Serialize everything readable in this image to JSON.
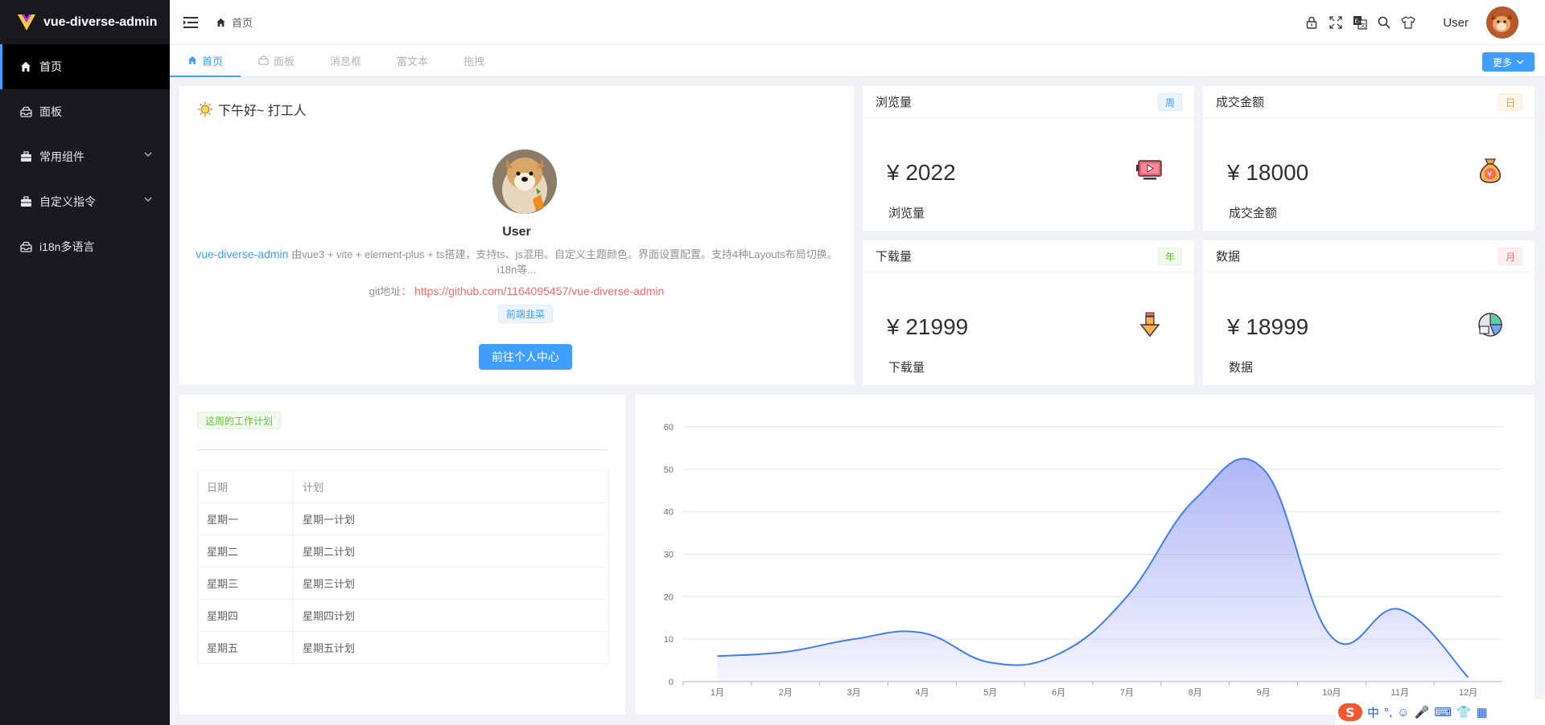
{
  "app": {
    "title": "vue-diverse-admin"
  },
  "sidebar": {
    "items": [
      {
        "label": "首页",
        "icon": "home-icon",
        "active": true
      },
      {
        "label": "面板",
        "icon": "dashboard-icon"
      },
      {
        "label": "常用组件",
        "icon": "briefcase-icon",
        "has_children": true
      },
      {
        "label": "自定义指令",
        "icon": "briefcase-icon",
        "has_children": true
      },
      {
        "label": "i18n多语言",
        "icon": "dashboard-icon"
      }
    ]
  },
  "header": {
    "breadcrumb": "首页",
    "user_name": "User",
    "icons": [
      "lock-icon",
      "fullscreen-icon",
      "translate-icon",
      "search-icon",
      "tshirt-icon"
    ]
  },
  "tabs": {
    "items": [
      "首页",
      "面板",
      "消息框",
      "富文本",
      "拖拽"
    ],
    "more_label": "更多"
  },
  "welcome": {
    "greeting": "下午好~ 打工人",
    "user_name": "User",
    "project_link": "vue-diverse-admin",
    "description": "由vue3 + vite + element-plus + ts搭建，支持ts、js混用。自定义主题颜色。界面设置配置。支持4种Layouts布局切换。i18n等...",
    "git_label": "git地址：",
    "git_url": "https://github.com/1164095457/vue-diverse-admin",
    "tag": "前端韭菜",
    "button": "前往个人中心"
  },
  "stats": [
    {
      "title": "浏览量",
      "badge": "周",
      "value": "¥ 2022",
      "label": "浏览量",
      "badge_color": "#409eff",
      "icon": "video-icon"
    },
    {
      "title": "成交金额",
      "badge": "日",
      "value": "¥ 18000",
      "label": "成交金额",
      "badge_color": "#e6a23c",
      "icon": "money-bag-icon"
    },
    {
      "title": "下载量",
      "badge": "年",
      "value": "¥ 21999",
      "label": "下载量",
      "badge_color": "#67c23a",
      "icon": "download-icon"
    },
    {
      "title": "数据",
      "badge": "月",
      "value": "¥ 18999",
      "label": "数据",
      "badge_color": "#f56c6c",
      "icon": "pie-chart-icon"
    }
  ],
  "plan": {
    "tag": "这周的工作计划",
    "columns": [
      "日期",
      "计划"
    ],
    "rows": [
      [
        "星期一",
        "星期一计划"
      ],
      [
        "星期二",
        "星期二计划"
      ],
      [
        "星期三",
        "星期三计划"
      ],
      [
        "星期四",
        "星期四计划"
      ],
      [
        "星期五",
        "星期五计划"
      ]
    ]
  },
  "chart_data": {
    "type": "area",
    "categories": [
      "1月",
      "2月",
      "3月",
      "4月",
      "5月",
      "6月",
      "7月",
      "8月",
      "9月",
      "10月",
      "11月",
      "12月"
    ],
    "series": [
      {
        "values": [
          6,
          7,
          10,
          11.5,
          4.5,
          6.5,
          20,
          43,
          50,
          10.5,
          17,
          1
        ]
      }
    ],
    "ylim": [
      0,
      60
    ],
    "yticks": [
      0,
      10,
      20,
      30,
      40,
      50,
      60
    ],
    "grid": true,
    "line_color": "#3f7ef6",
    "fill_color": "#aab2f5"
  },
  "ime": {
    "items": [
      "中",
      "°,",
      "☺",
      "🎤",
      "⌨",
      "👕",
      "▦"
    ]
  }
}
